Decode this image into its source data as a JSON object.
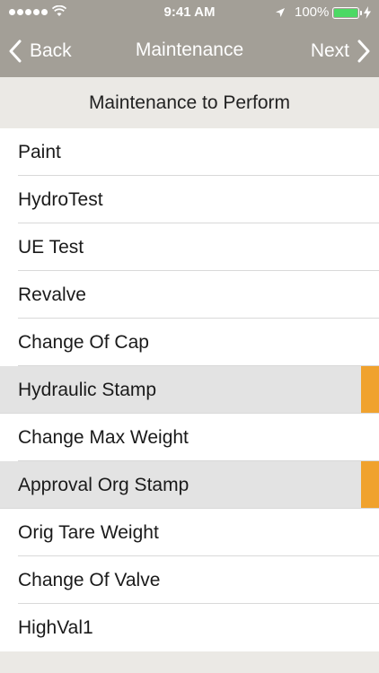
{
  "status_bar": {
    "time": "9:41 AM",
    "battery_percent": "100%"
  },
  "nav": {
    "back_label": "Back",
    "title": "Maintenance",
    "next_label": "Next"
  },
  "section": {
    "header": "Maintenance to Perform"
  },
  "items": [
    {
      "label": "Paint",
      "selected": false
    },
    {
      "label": "HydroTest",
      "selected": false
    },
    {
      "label": "UE Test",
      "selected": false
    },
    {
      "label": "Revalve",
      "selected": false
    },
    {
      "label": "Change Of Cap",
      "selected": false
    },
    {
      "label": "Hydraulic Stamp",
      "selected": true
    },
    {
      "label": "Change Max Weight",
      "selected": false
    },
    {
      "label": "Approval Org Stamp",
      "selected": true
    },
    {
      "label": "Orig Tare Weight",
      "selected": false
    },
    {
      "label": "Change Of Valve",
      "selected": false
    },
    {
      "label": "HighVal1",
      "selected": false
    }
  ],
  "colors": {
    "nav_background": "#a39f97",
    "selected_row": "#e3e3e3",
    "selection_marker": "#f0a22e",
    "battery": "#4cd964"
  },
  "icons": {
    "back": "chevron-left-icon",
    "next": "chevron-right-icon",
    "wifi": "wifi-icon",
    "location": "location-arrow-icon",
    "battery": "battery-icon",
    "charging": "bolt-icon"
  }
}
